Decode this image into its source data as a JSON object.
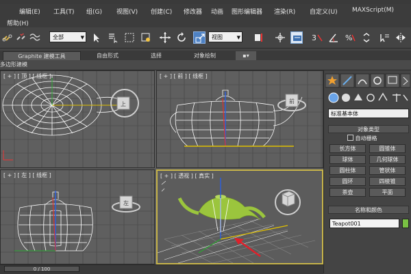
{
  "menu": {
    "items": [
      "编辑(E)",
      "工具(T)",
      "组(G)",
      "视图(V)",
      "创建(C)",
      "修改器",
      "动画",
      "图形编辑器",
      "渲染(R)",
      "自定义(U)",
      "MAXScript(M)"
    ],
    "help": "帮助(H)"
  },
  "toolbar": {
    "selection_filter": "全部",
    "reference_coord": "视图"
  },
  "ribbon": {
    "tabs": [
      "Graphite 建模工具",
      "自由形式",
      "选择",
      "对象绘制"
    ],
    "sub_label": "多边形建模"
  },
  "viewports": {
    "top": "[ + ] [ 顶 ] [ 线框 ]",
    "front": "[ + ] [ 前 ] [ 线框 ]",
    "left": "[ + ] [ 左 ] [ 线框 ]",
    "perspective": "[ + ] [ 透视 ] [ 真实 ]"
  },
  "viewcube": {
    "top_face": "上",
    "front_face": "前",
    "left_face": "左"
  },
  "command_panel": {
    "category": "标准基本体",
    "object_type_title": "对象类型",
    "autogrid_label": "自动栅格",
    "autogrid_checked": false,
    "buttons": [
      "长方体",
      "圆锥体",
      "球体",
      "几何球体",
      "圆柱体",
      "管状体",
      "圆环",
      "四棱锥",
      "茶壶",
      "平面"
    ],
    "name_color_title": "名称和颜色",
    "object_name": "Teapot001",
    "object_color": "#7ac143"
  },
  "status": {
    "time_slider": "0 / 100"
  },
  "colors": {
    "wire_white": "#ffffff",
    "teapot_green": "#9bc53d",
    "active_border": "#c8b54a",
    "arrow_red": "#e0202a"
  }
}
